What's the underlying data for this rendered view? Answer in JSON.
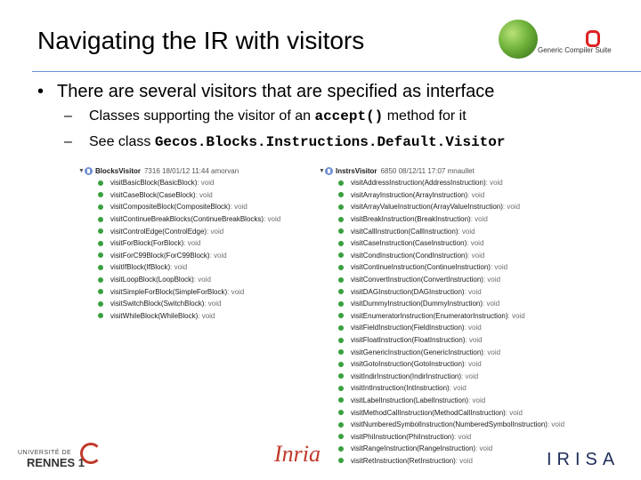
{
  "slide": {
    "title": "Navigating the IR with visitors",
    "bullet": "There are several visitors that are specified as interface",
    "bullet_marker": "•",
    "sub_dash": "–",
    "sub1_pre": "Classes supporting the visitor of an ",
    "sub1_code": "accept()",
    "sub1_post": " method for it",
    "sub2_pre": "See class ",
    "sub2_code": "Gecos.Blocks.Instructions.Default.Visitor"
  },
  "logos": {
    "gecos_caption": "Generic Compiler Suite",
    "rennes_top": "UNIVERSITÉ DE",
    "rennes_main": "RENNES 1",
    "inria": "Inria",
    "irisa": "IRISA"
  },
  "left_tree": {
    "class_name": "BlocksVisitor",
    "meta": "7316  18/01/12 11:44  amorvan",
    "methods": [
      {
        "name": "visitBasicBlock(BasicBlock)",
        "ret": " : void"
      },
      {
        "name": "visitCaseBlock(CaseBlock)",
        "ret": " : void"
      },
      {
        "name": "visitCompositeBlock(CompositeBlock)",
        "ret": " : void"
      },
      {
        "name": "visitContinueBreakBlocks(ContinueBreakBlocks)",
        "ret": " : void"
      },
      {
        "name": "visitControlEdge(ControlEdge)",
        "ret": " : void"
      },
      {
        "name": "visitForBlock(ForBlock)",
        "ret": " : void"
      },
      {
        "name": "visitForC99Block(ForC99Block)",
        "ret": " : void"
      },
      {
        "name": "visitIfBlock(IfBlock)",
        "ret": " : void"
      },
      {
        "name": "visitLoopBlock(LoopBlock)",
        "ret": " : void"
      },
      {
        "name": "visitSimpleForBlock(SimpleForBlock)",
        "ret": " : void"
      },
      {
        "name": "visitSwitchBlock(SwitchBlock)",
        "ret": " : void"
      },
      {
        "name": "visitWhileBlock(WhileBlock)",
        "ret": " : void"
      }
    ]
  },
  "right_tree": {
    "class_name": "InstrsVisitor",
    "meta": "6850  08/12/11 17:07  mnaullet",
    "methods": [
      {
        "name": "visitAddressInstruction(AddressInstruction)",
        "ret": " : void"
      },
      {
        "name": "visitArrayInstruction(ArrayInstruction)",
        "ret": " : void"
      },
      {
        "name": "visitArrayValueInstruction(ArrayValueInstruction)",
        "ret": " : void"
      },
      {
        "name": "visitBreakInstruction(BreakInstruction)",
        "ret": " : void"
      },
      {
        "name": "visitCallInstruction(CallInstruction)",
        "ret": " : void"
      },
      {
        "name": "visitCaseInstruction(CaseInstruction)",
        "ret": " : void"
      },
      {
        "name": "visitCondInstruction(CondInstruction)",
        "ret": " : void"
      },
      {
        "name": "visitContinueInstruction(ContinueInstruction)",
        "ret": " : void"
      },
      {
        "name": "visitConvertInstruction(ConvertInstruction)",
        "ret": " : void"
      },
      {
        "name": "visitDAGInstruction(DAGInstruction)",
        "ret": " : void"
      },
      {
        "name": "visitDummyInstruction(DummyInstruction)",
        "ret": " : void"
      },
      {
        "name": "visitEnumeratorInstruction(EnumeratorInstruction)",
        "ret": " : void"
      },
      {
        "name": "visitFieldInstruction(FieldInstruction)",
        "ret": " : void"
      },
      {
        "name": "visitFloatInstruction(FloatInstruction)",
        "ret": " : void"
      },
      {
        "name": "visitGenericInstruction(GenericInstruction)",
        "ret": " : void"
      },
      {
        "name": "visitGotoInstruction(GotoInstruction)",
        "ret": " : void"
      },
      {
        "name": "visitIndirInstruction(IndirInstruction)",
        "ret": " : void"
      },
      {
        "name": "visitIntInstruction(IntInstruction)",
        "ret": " : void"
      },
      {
        "name": "visitLabelInstruction(LabelInstruction)",
        "ret": " : void"
      },
      {
        "name": "visitMethodCallInstruction(MethodCallInstruction)",
        "ret": " : void"
      },
      {
        "name": "visitNumberedSymbolInstruction(NumberedSymbolInstruction)",
        "ret": " : void"
      },
      {
        "name": "visitPhiInstruction(PhiInstruction)",
        "ret": " : void"
      },
      {
        "name": "visitRangeInstruction(RangeInstruction)",
        "ret": " : void"
      },
      {
        "name": "visitRetInstruction(RetInstruction)",
        "ret": " : void"
      }
    ]
  }
}
